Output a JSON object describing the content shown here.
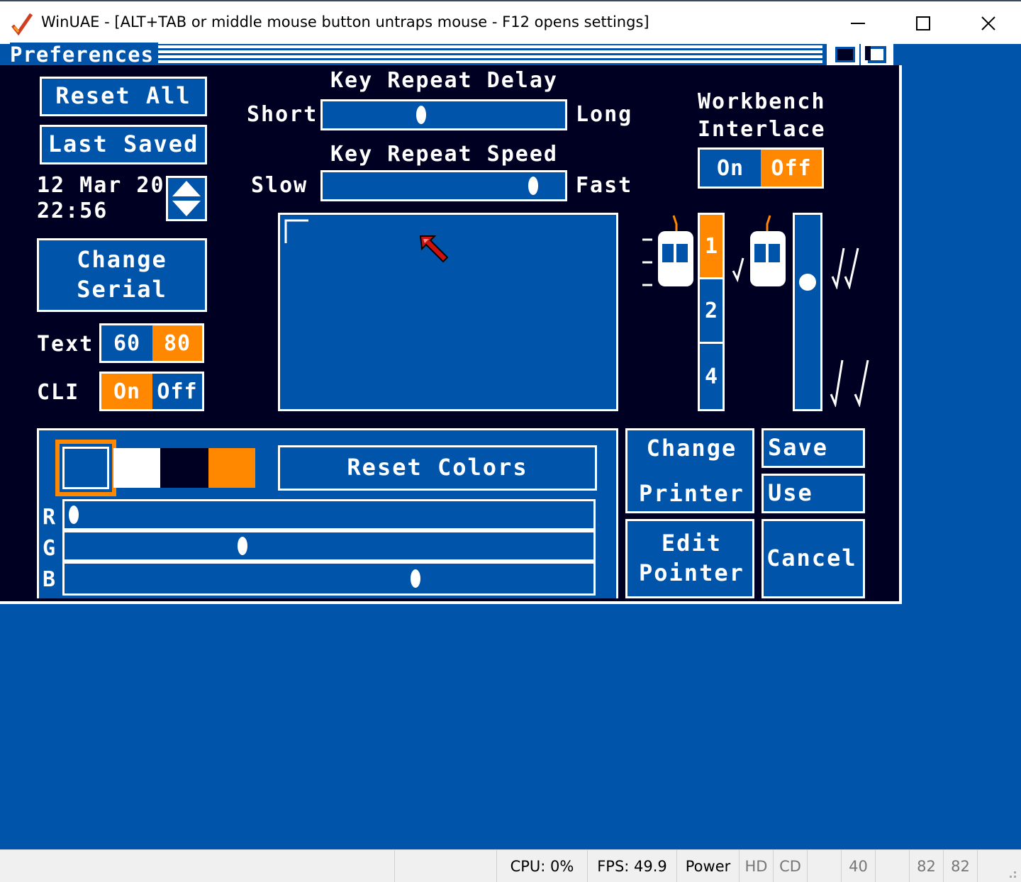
{
  "window": {
    "title": "WinUAE - [ALT+TAB or middle mouse button untraps mouse - F12 opens settings]"
  },
  "screen": {
    "title": "Preferences"
  },
  "prefs": {
    "reset_all": "Reset All",
    "last_saved": "Last Saved",
    "date": "12 Mar 20",
    "time": "22:56",
    "change_serial": "Change\nSerial",
    "text_label": "Text",
    "text_options": [
      "60",
      "80"
    ],
    "text_selected": "80",
    "cli_label": "CLI",
    "cli_options": [
      "On",
      "Off"
    ],
    "cli_selected": "On",
    "key_repeat_delay": {
      "label": "Key Repeat Delay",
      "min": "Short",
      "max": "Long",
      "value": 0.4
    },
    "key_repeat_speed": {
      "label": "Key Repeat Speed",
      "min": "Slow",
      "max": "Fast",
      "value": 0.9
    },
    "workbench_interlace": {
      "label": "Workbench\nInterlace",
      "options": [
        "On",
        "Off"
      ],
      "selected": "Off"
    },
    "mouse_speed": {
      "options": [
        "1",
        "2",
        "4"
      ],
      "selected": "1"
    },
    "double_click": {
      "value": 0.33
    },
    "palette": [
      "#0055aa",
      "#ffffff",
      "#000022",
      "#ff8800"
    ],
    "reset_colors": "Reset Colors",
    "rgb": [
      {
        "label": "R",
        "value": 0.0
      },
      {
        "label": "G",
        "value": 0.33
      },
      {
        "label": "B",
        "value": 0.67
      }
    ],
    "change_printer": "Change\n\nPrinter",
    "edit_pointer": "Edit\nPointer",
    "save": "Save",
    "use": "Use",
    "cancel": "Cancel"
  },
  "statusbar": {
    "cpu": "CPU: 0%",
    "fps": "FPS: 49.9",
    "power": "Power",
    "hd": "HD",
    "cd": "CD",
    "track": "40",
    "df0": "82",
    "df1": "82"
  },
  "colors": {
    "amiga_blue": "#0055aa",
    "amiga_orange": "#ff8800",
    "amiga_black": "#000022",
    "amiga_white": "#ffffff"
  }
}
